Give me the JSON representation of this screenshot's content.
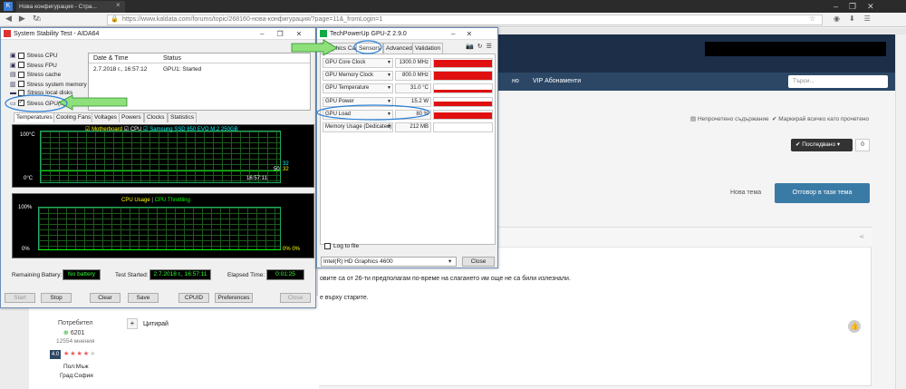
{
  "browser": {
    "tab_title": "Нова конфигурация - Стра...",
    "url": "https://www.kaldata.com/forums/topic/268160-нова-конфигурация/?page=11&_fromLogin=1"
  },
  "site": {
    "nav_item": "VIP Абонаменти",
    "nav_item_partial": "но",
    "search_placeholder": "Търси...",
    "unread_content": "Непрочетено съдържание",
    "mark_all_read": "Маркирай всичко като прочетено",
    "sort_label": "Последвано",
    "sort_count": "0",
    "new_topic": "Нова тема",
    "reply_topic": "Отговор в тази тема",
    "post_text_1": "овите са от 26-ти предполагам по-време на слагането им още не са били излезнали.",
    "post_text_2": "е върху старите.",
    "quote_label": "Цитирай",
    "user": {
      "title": "Потребител",
      "reputation": "6201",
      "posts": "12554 мнения",
      "rating": "4.0",
      "gender": "Пол:Мъж",
      "city": "Град:София"
    }
  },
  "aida": {
    "title": "System Stability Test - AIDA64",
    "stress_items": [
      {
        "label": "Stress CPU",
        "checked": false
      },
      {
        "label": "Stress FPU",
        "checked": false
      },
      {
        "label": "Stress cache",
        "checked": false
      },
      {
        "label": "Stress system memory",
        "checked": false
      },
      {
        "label": "Stress local disks",
        "checked": false
      },
      {
        "label": "Stress GPU(s)",
        "checked": true
      }
    ],
    "log_headers": [
      "Date & Time",
      "Status"
    ],
    "log_rows": [
      [
        "2.7.2018 г., 16:57:12",
        "GPU1: Started"
      ]
    ],
    "tabs": [
      "Temperatures",
      "Cooling Fans",
      "Voltages",
      "Powers",
      "Clocks",
      "Statistics"
    ],
    "temp_legend": [
      "Motherboard",
      "CPU",
      "Samsung SSD 850 EVO M.2 250GB"
    ],
    "temp_ymax": "100°C",
    "temp_ymin": "0°C",
    "temp_time": "16:57:11",
    "temp_val1": "32",
    "temp_val2": "32",
    "temp_val3": "50",
    "cpu_legend": [
      "CPU Usage",
      "CPU Throttling"
    ],
    "cpu_ymax": "100%",
    "cpu_ymin": "0%",
    "cpu_val": "0% 0%",
    "battery_label": "Remaining Battery:",
    "battery_value": "No battery",
    "started_label": "Test Started:",
    "started_value": "2.7.2018 г., 16:57:11",
    "elapsed_label": "Elapsed Time:",
    "elapsed_value": "0:01:25",
    "buttons": [
      "Start",
      "Stop",
      "Clear",
      "Save",
      "CPUID",
      "Preferences",
      "Close"
    ]
  },
  "gpuz": {
    "title": "TechPowerUp GPU-Z 2.9.0",
    "tabs": [
      "Graphics Card",
      "Sensors",
      "Advanced",
      "Validation"
    ],
    "sensors": [
      {
        "label": "GPU Core Clock",
        "value": "1300.0 MHz",
        "level": 0.9
      },
      {
        "label": "GPU Memory Clock",
        "value": "800.0 MHz",
        "level": 0.95
      },
      {
        "label": "GPU Temperature",
        "value": "31.0 °C",
        "level": 0.35
      },
      {
        "label": "GPU Power",
        "value": "15.2 W",
        "level": 0.5
      },
      {
        "label": "GPU Load",
        "value": "80 %",
        "level": 0.8
      },
      {
        "label": "Memory Usage (Dedicated)",
        "value": "212 MB",
        "level": 0
      }
    ],
    "log_to_file": "Log to file",
    "device": "Intel(R) HD Graphics 4600",
    "close": "Close"
  }
}
